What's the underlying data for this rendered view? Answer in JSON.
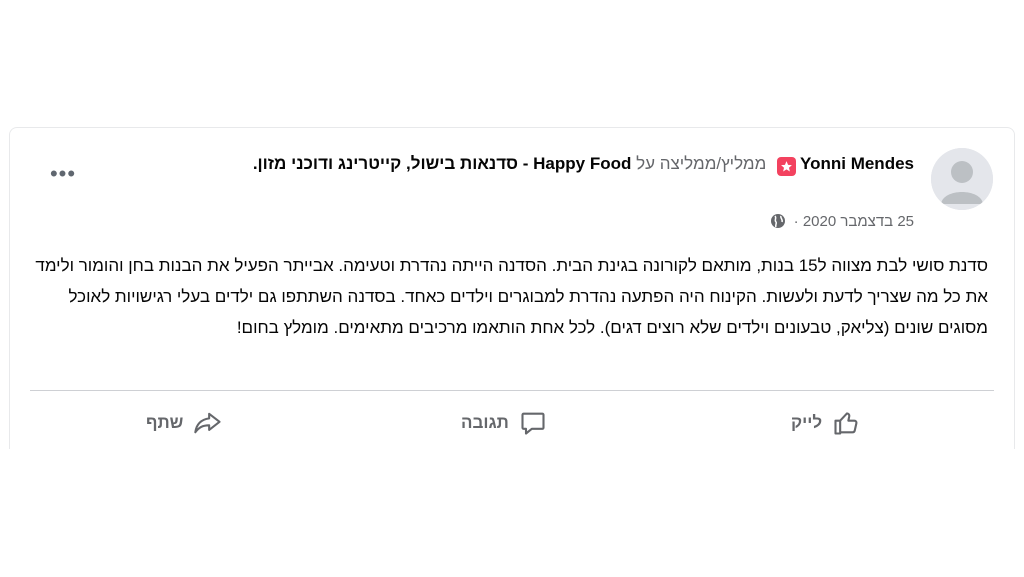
{
  "post": {
    "author": "Yonni Mendes",
    "recommends_text": "ממליץ/ממליצה על",
    "page_name": "Happy Food - סדנאות בישול, קייטרינג ודוכני מזון.",
    "date": "25 בדצמבר 2020",
    "date_separator": "·",
    "more_label": "•••",
    "body": "סדנת סושי לבת מצווה ל15 בנות, מותאם לקורונה בגינת הבית. הסדנה הייתה נהדרת וטעימה. אבייתר הפעיל את הבנות בחן והומור ולימד את כל מה שצריך לדעת ולעשות. הקינוח היה הפתעה נהדרת למבוגרים וילדים כאחד. בסדנה השתתפו גם ילדים בעלי רגישויות לאוכל מסוגים שונים (צליאק, טבעונים וילדים שלא רוצים דגים). לכל אחת הותאמו מרכיבים מתאימים. מומלץ בחום!"
  },
  "actions": {
    "like": "לייק",
    "comment": "תגובה",
    "share": "שתף"
  },
  "icons": {
    "badge": "recommend-star-icon",
    "privacy": "globe-icon",
    "like": "thumbs-up-icon",
    "comment": "comment-bubble-icon",
    "share": "share-arrow-icon"
  },
  "colors": {
    "badge": "#f3425f",
    "secondary_text": "#65676b",
    "primary_text": "#050505",
    "divider": "#ced0d4"
  }
}
